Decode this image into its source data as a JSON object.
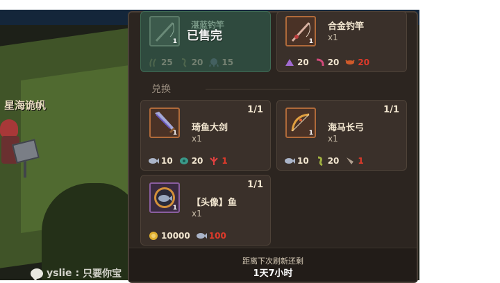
{
  "scene": {
    "location_label": "星海诡帆",
    "chat": {
      "user": "yslie",
      "message": "只要你宝"
    }
  },
  "shop": {
    "sold_out_label": "已售完",
    "section_label": "兑换",
    "footer": {
      "refresh_label": "距离下次刷新还剩",
      "refresh_time": "1天7小时"
    },
    "top_items": [
      {
        "name": "湛蓝钓竿",
        "icon": "fishing-rod-icon",
        "thumb_count": "1",
        "sold_out": true,
        "costs": [
          {
            "icon": "seaweed-icon",
            "amount": "25",
            "color": "#8a9a6a"
          },
          {
            "icon": "seahorse-icon",
            "amount": "20",
            "color": "#8a9a6a"
          },
          {
            "icon": "octopus-icon",
            "amount": "15",
            "color": "#6a8aa0"
          }
        ]
      },
      {
        "name": "合金钓竿",
        "icon": "fishing-rod-icon",
        "qty": "x1",
        "thumb_count": "1",
        "sold_out": false,
        "costs": [
          {
            "icon": "shell-icon",
            "amount": "20",
            "color": "#a06ad0",
            "red": false
          },
          {
            "icon": "shrimp-icon",
            "amount": "20",
            "color": "#d04a7a",
            "red": false
          },
          {
            "icon": "crayfish-icon",
            "amount": "20",
            "color": "#d05a2a",
            "red": true
          }
        ]
      }
    ],
    "exchange_items": [
      {
        "name": "琦鱼大剑",
        "icon": "sword-icon",
        "qty": "x1",
        "thumb_count": "1",
        "stock": "1/1",
        "costs": [
          {
            "icon": "fish-icon",
            "amount": "10",
            "color": "#aab4c8",
            "red": false
          },
          {
            "icon": "turtle-icon",
            "amount": "20",
            "color": "#3a9a8a",
            "red": false
          },
          {
            "icon": "coral-icon",
            "amount": "1",
            "color": "#e04040",
            "red": true
          }
        ]
      },
      {
        "name": "海马长弓",
        "icon": "bow-icon",
        "qty": "x1",
        "thumb_count": "1",
        "stock": "1/1",
        "costs": [
          {
            "icon": "fish-icon",
            "amount": "10",
            "color": "#aab4c8",
            "red": false
          },
          {
            "icon": "seahorse-icon",
            "amount": "20",
            "color": "#a0b040",
            "red": false
          },
          {
            "icon": "squid-icon",
            "amount": "1",
            "color": "#b0a090",
            "red": true
          }
        ]
      },
      {
        "name": "【头像】鱼",
        "icon": "avatar-fish-icon",
        "qty": "x1",
        "thumb_count": "1",
        "stock": "1/1",
        "costs": [
          {
            "icon": "gold-coin-icon",
            "amount": "10000",
            "color": "#e0b030",
            "red": false
          },
          {
            "icon": "fish-icon",
            "amount": "100",
            "color": "#aab4c8",
            "red": true
          }
        ]
      }
    ]
  }
}
